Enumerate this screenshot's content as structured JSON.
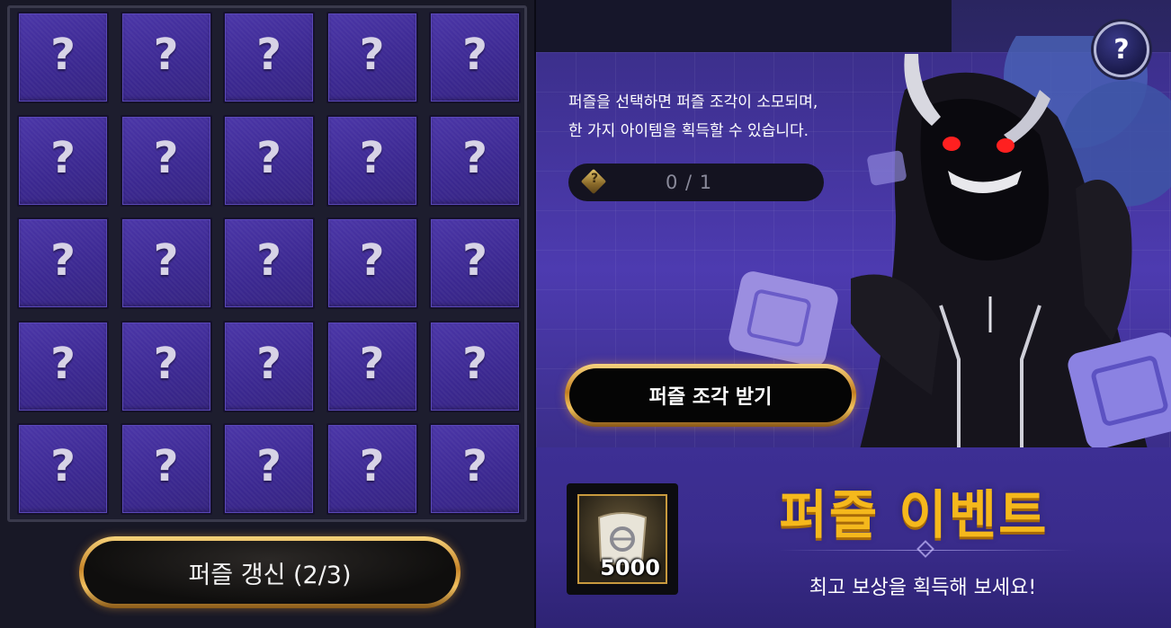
{
  "puzzle_grid": {
    "tile_label": "?",
    "rows": 5,
    "cols": 5
  },
  "refresh_button": {
    "label": "퍼즐 갱신 (2/3)"
  },
  "info": {
    "line1": "퍼즐을 선택하면 퍼즐 조각이 소모되며,",
    "line2": "한 가지 아이템을 획득할 수 있습니다.",
    "piece_count": "0 / 1",
    "piece_icon": "puzzle-piece-gem-icon"
  },
  "help_button": {
    "label": "?"
  },
  "get_pieces_button": {
    "label": "퍼즐 조각 받기"
  },
  "reward": {
    "icon": "scroll-icon",
    "quantity": "5000"
  },
  "event": {
    "title": "퍼즐 이벤트",
    "subtitle": "최고 보상을 획득해 보세요!"
  },
  "colors": {
    "tile": "#4b36a8",
    "gold": "#f5b81c",
    "background": "#3c2f8c"
  }
}
